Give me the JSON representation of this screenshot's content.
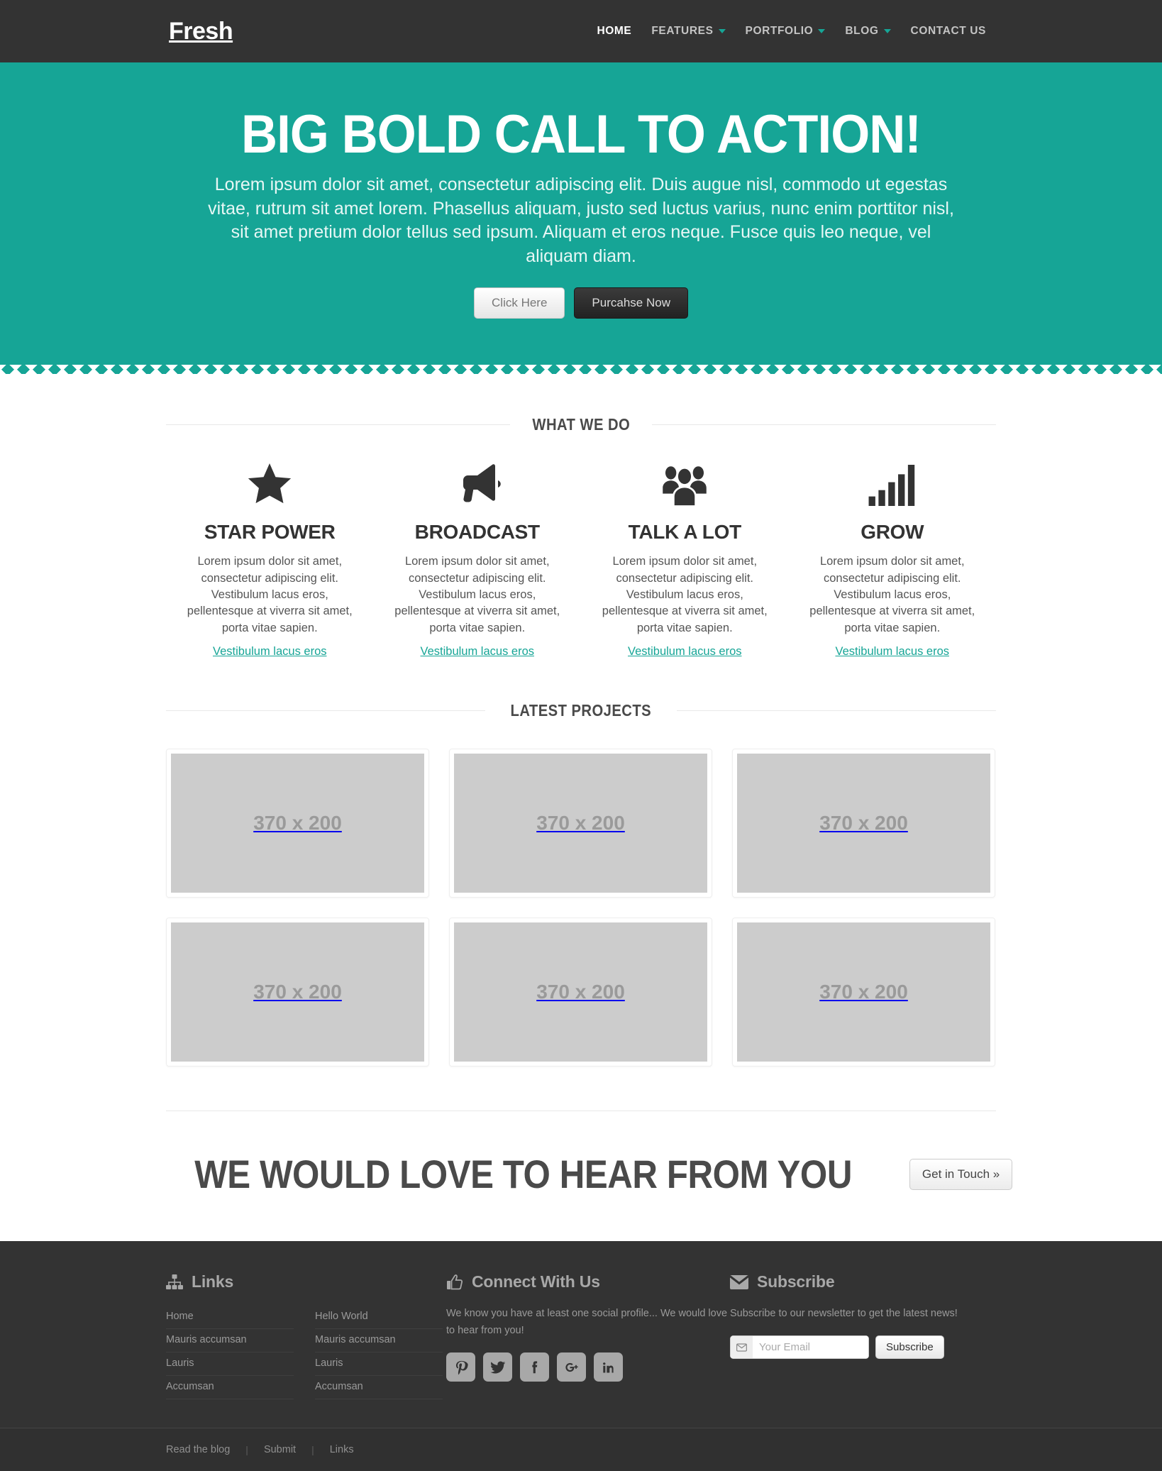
{
  "colors": {
    "brand_teal": "#16a596",
    "dark": "#333333",
    "link_teal": "#16a596"
  },
  "navbar": {
    "brand": "Fresh",
    "items": [
      {
        "label": "HOME",
        "has_caret": false,
        "active": true
      },
      {
        "label": "FEATURES",
        "has_caret": true,
        "active": false
      },
      {
        "label": "PORTFOLIO",
        "has_caret": true,
        "active": false
      },
      {
        "label": "BLOG",
        "has_caret": true,
        "active": false
      },
      {
        "label": "CONTACT US",
        "has_caret": false,
        "active": false
      }
    ]
  },
  "hero": {
    "title": "BIG BOLD CALL TO ACTION!",
    "paragraph": "Lorem ipsum dolor sit amet, consectetur adipiscing elit. Duis augue nisl, commodo ut egestas vitae, rutrum sit amet lorem. Phasellus aliquam, justo sed luctus varius, nunc enim porttitor nisl, sit amet pretium dolor tellus sed ipsum. Aliquam et eros neque. Fusce quis leo neque, vel aliquam diam.",
    "primary_button": "Click Here",
    "secondary_button": "Purcahse Now"
  },
  "what_we_do": {
    "heading": "WHAT WE DO",
    "features": [
      {
        "icon": "star-icon",
        "title": "STAR POWER",
        "text": "Lorem ipsum dolor sit amet, consectetur adipiscing elit. Vestibulum lacus eros, pellentesque at viverra sit amet, porta vitae sapien.",
        "link": "Vestibulum lacus eros"
      },
      {
        "icon": "megaphone-icon",
        "title": "BROADCAST",
        "text": "Lorem ipsum dolor sit amet, consectetur adipiscing elit. Vestibulum lacus eros, pellentesque at viverra sit amet, porta vitae sapien.",
        "link": "Vestibulum lacus eros"
      },
      {
        "icon": "group-icon",
        "title": "TALK A LOT",
        "text": "Lorem ipsum dolor sit amet, consectetur adipiscing elit. Vestibulum lacus eros, pellentesque at viverra sit amet, porta vitae sapien.",
        "link": "Vestibulum lacus eros"
      },
      {
        "icon": "bar-chart-icon",
        "title": "GROW",
        "text": "Lorem ipsum dolor sit amet, consectetur adipiscing elit. Vestibulum lacus eros, pellentesque at viverra sit amet, porta vitae sapien.",
        "link": "Vestibulum lacus eros"
      }
    ]
  },
  "latest_projects": {
    "heading": "LATEST PROJECTS",
    "projects": [
      {
        "placeholder": "370 x 200"
      },
      {
        "placeholder": "370 x 200"
      },
      {
        "placeholder": "370 x 200"
      },
      {
        "placeholder": "370 x 200"
      },
      {
        "placeholder": "370 x 200"
      },
      {
        "placeholder": "370 x 200"
      }
    ]
  },
  "cta": {
    "heading": "WE WOULD LOVE TO HEAR FROM YOU",
    "button": "Get in Touch »"
  },
  "footer": {
    "links": {
      "icon": "sitemap-icon",
      "heading": "Links",
      "column_one": [
        "Home",
        "Mauris accumsan",
        "Lauris",
        "Accumsan"
      ],
      "column_two": [
        "Hello World",
        "Mauris accumsan",
        "Lauris",
        "Accumsan"
      ]
    },
    "social": {
      "icon": "thumbs-up-icon",
      "heading": "Connect With Us",
      "description": "We know you have at least one social profile... We would love to hear from you!",
      "networks": [
        "pinterest-icon",
        "twitter-icon",
        "facebook-icon",
        "google-plus-icon",
        "linkedin-icon"
      ]
    },
    "subscribe": {
      "icon": "envelope-icon",
      "heading": "Subscribe",
      "description": "Subscribe to our newsletter to get the latest news!",
      "input_placeholder": "Your Email",
      "input_value": "",
      "button": "Subscribe"
    },
    "bottom_links": [
      "Read the blog",
      "Submit",
      "Links"
    ],
    "separator": "|"
  }
}
